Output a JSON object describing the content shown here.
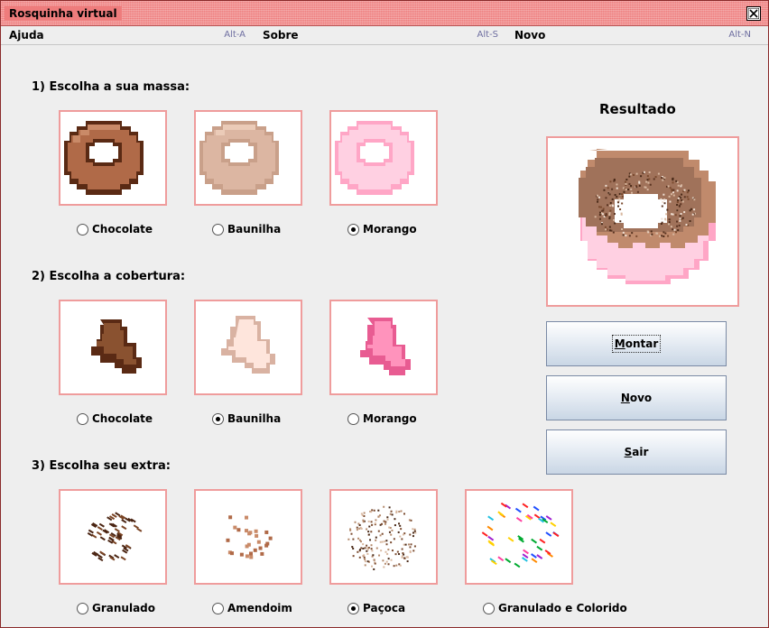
{
  "window": {
    "title": "Rosquinha virtual"
  },
  "menu": [
    {
      "label": "Ajuda",
      "accelerator": "Alt-A"
    },
    {
      "label": "Sobre",
      "accelerator": "Alt-S"
    },
    {
      "label": "Novo",
      "accelerator": "Alt-N"
    }
  ],
  "sections": {
    "massa": {
      "title": "1) Escolha a sua massa:",
      "options": [
        "Chocolate",
        "Baunilha",
        "Morango"
      ],
      "selected": "Morango"
    },
    "cobertura": {
      "title": "2) Escolha a cobertura:",
      "options": [
        "Chocolate",
        "Baunilha",
        "Morango"
      ],
      "selected": "Baunilha"
    },
    "extra": {
      "title": "3) Escolha seu extra:",
      "options": [
        "Granulado",
        "Amendoim",
        "Paçoca",
        "Granulado e Colorido"
      ],
      "selected": "Paçoca"
    }
  },
  "result": {
    "title": "Resultado"
  },
  "buttons": [
    {
      "label": "Montar",
      "mnemonic": "M",
      "rest": "ontar",
      "focused": true
    },
    {
      "label": "Novo",
      "mnemonic": "N",
      "rest": "ovo",
      "focused": false
    },
    {
      "label": "Sair",
      "mnemonic": "S",
      "rest": "air",
      "focused": false
    }
  ],
  "colors": {
    "title_bar": "#ee7c7c",
    "tile_border": "#ef9c9c",
    "chocolate": "#b06a48",
    "chocolate_dark": "#5a2a14",
    "baunilha": "#d7ac98",
    "morango": "#ffc8dc",
    "morango_dark": "#ff90b8"
  }
}
